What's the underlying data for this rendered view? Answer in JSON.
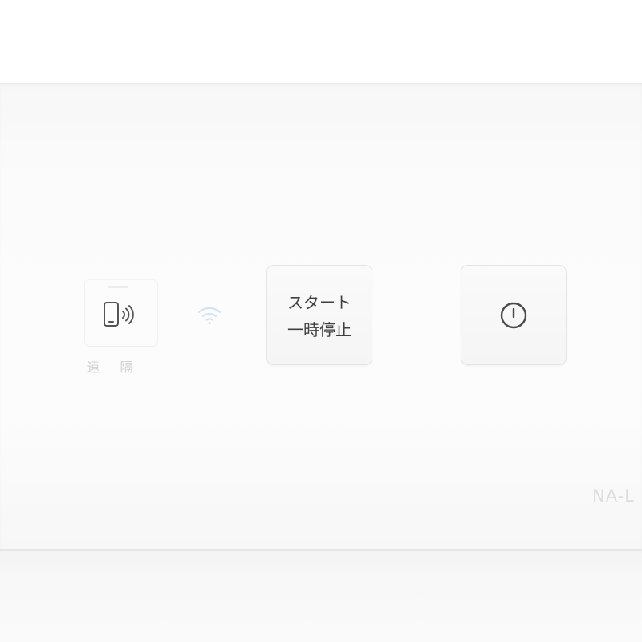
{
  "panel": {
    "remote": {
      "label": "遠 隔",
      "icon": "smartphone-remote-icon"
    },
    "wifi": {
      "icon": "wifi-icon"
    },
    "start_button": {
      "line1": "スタート",
      "line2": "一時停止"
    },
    "power_button": {
      "icon": "power-icon"
    },
    "model_text": "NA-L"
  },
  "colors": {
    "panel_background": "#fbfbfb",
    "button_text": "#3f3f3f",
    "faint_print": "#cfcfcf",
    "wifi_icon": "#d6e4f2"
  }
}
